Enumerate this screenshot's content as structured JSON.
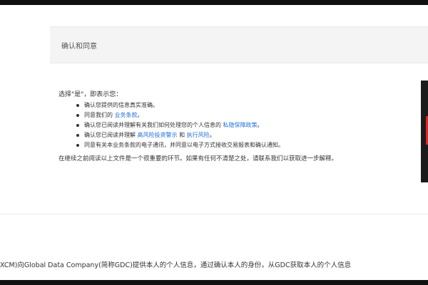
{
  "section": {
    "title": "确认和同意"
  },
  "consent": {
    "intro": "选择\"是\"，即表示您：",
    "items": [
      {
        "text": "确认您提供的信息真实准确。"
      },
      {
        "text": "同意我们的 ",
        "link": "业务条款",
        "after": "。"
      },
      {
        "text": "确认您已阅读并理解有关我们如何处理您的个人信息的 ",
        "link": "私隐保障政策",
        "after": "。"
      },
      {
        "text": "确认您已阅读并理解 ",
        "link": "高风险投资警示",
        "mid": " 和 ",
        "link2": "执行风险",
        "after": "。"
      },
      {
        "text": "同意有关本业务条款的电子通讯，并同意以电子方式接收交易报表和确认通知。"
      }
    ],
    "reminder": "在继续之前阅读以上文件是一个很重要的环节。如果有任何不清楚之处，请联系我们以获取进一步解释。"
  },
  "footer": {
    "text": "XCM)向Global Data Company(简称GDC)提供本人的个人信息，通过确认本人的身份，从GDC获取本人的个人信息"
  }
}
